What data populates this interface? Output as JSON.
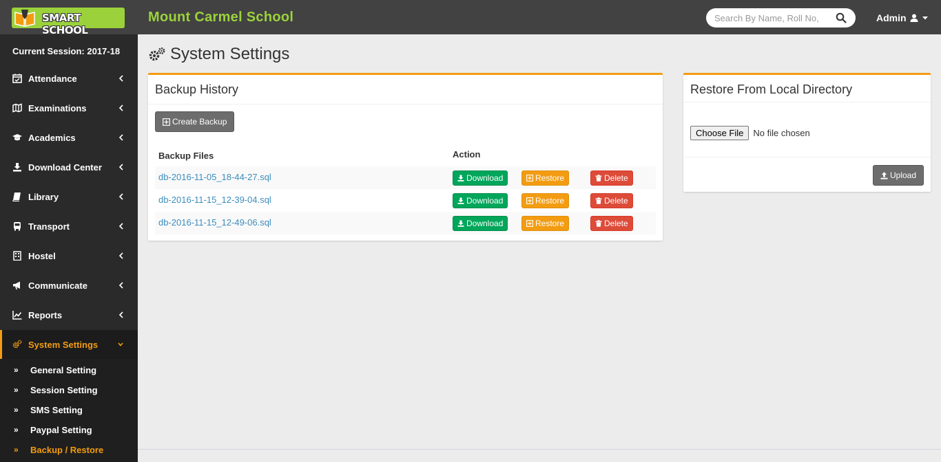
{
  "header": {
    "logo_text": "SMART SCHOOL",
    "school_name": "Mount Carmel School",
    "search_placeholder": "Search By Name, Roll No,",
    "user": "Admin"
  },
  "sidebar": {
    "session": "Current Session: 2017-18",
    "items": [
      {
        "label": "Attendance",
        "icon": "calendar-check-icon"
      },
      {
        "label": "Examinations",
        "icon": "map-icon"
      },
      {
        "label": "Academics",
        "icon": "graduation-cap-icon"
      },
      {
        "label": "Download Center",
        "icon": "download-icon"
      },
      {
        "label": "Library",
        "icon": "book-icon"
      },
      {
        "label": "Transport",
        "icon": "bus-icon"
      },
      {
        "label": "Hostel",
        "icon": "building-icon"
      },
      {
        "label": "Communicate",
        "icon": "bullhorn-icon"
      },
      {
        "label": "Reports",
        "icon": "line-chart-icon"
      },
      {
        "label": "System Settings",
        "icon": "cogs-icon"
      }
    ],
    "sub_items": [
      {
        "label": "General Setting"
      },
      {
        "label": "Session Setting"
      },
      {
        "label": "SMS Setting"
      },
      {
        "label": "Paypal Setting"
      },
      {
        "label": "Backup / Restore"
      }
    ]
  },
  "page": {
    "title": "System Settings"
  },
  "backup": {
    "title": "Backup History",
    "create_label": "Create Backup",
    "col_files": "Backup Files",
    "col_action": "Action",
    "download_label": "Download",
    "restore_label": "Restore",
    "delete_label": "Delete",
    "files": [
      "db-2016-11-05_18-44-27.sql",
      "db-2016-11-15_12-39-04.sql",
      "db-2016-11-15_12-49-06.sql"
    ]
  },
  "restore": {
    "title": "Restore From Local Directory",
    "choose_label": "Choose File",
    "no_file": "No file chosen",
    "upload_label": "Upload"
  },
  "colors": {
    "brand_green": "#9bd23c",
    "accent_orange": "#f39c12",
    "header_bg": "#424242",
    "sidebar_bg": "#2a2a2a",
    "success": "#00a65a",
    "danger": "#dd4b39",
    "link": "#3c8dbc"
  }
}
